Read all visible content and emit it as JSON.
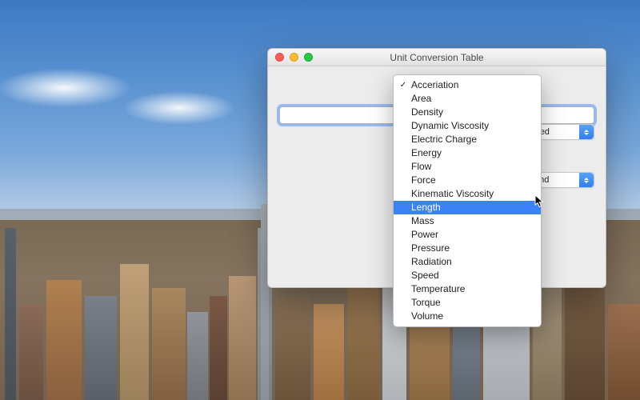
{
  "window": {
    "title": "Unit Conversion Table"
  },
  "input": {
    "value": ""
  },
  "quantity_select": {
    "selected": "Acceriation",
    "options": [
      {
        "label": "Acceriation",
        "checked": true,
        "highlighted": false
      },
      {
        "label": "Area",
        "checked": false,
        "highlighted": false
      },
      {
        "label": "Density",
        "checked": false,
        "highlighted": false
      },
      {
        "label": "Dynamic Viscosity",
        "checked": false,
        "highlighted": false
      },
      {
        "label": "Electric Charge",
        "checked": false,
        "highlighted": false
      },
      {
        "label": "Energy",
        "checked": false,
        "highlighted": false
      },
      {
        "label": "Flow",
        "checked": false,
        "highlighted": false
      },
      {
        "label": "Force",
        "checked": false,
        "highlighted": false
      },
      {
        "label": "Kinematic Viscosity",
        "checked": false,
        "highlighted": false
      },
      {
        "label": "Length",
        "checked": false,
        "highlighted": true
      },
      {
        "label": "Mass",
        "checked": false,
        "highlighted": false
      },
      {
        "label": "Power",
        "checked": false,
        "highlighted": false
      },
      {
        "label": "Pressure",
        "checked": false,
        "highlighted": false
      },
      {
        "label": "Radiation",
        "checked": false,
        "highlighted": false
      },
      {
        "label": "Speed",
        "checked": false,
        "highlighted": false
      },
      {
        "label": "Temperature",
        "checked": false,
        "highlighted": false
      },
      {
        "label": "Torque",
        "checked": false,
        "highlighted": false
      },
      {
        "label": "Volume",
        "checked": false,
        "highlighted": false
      }
    ]
  },
  "from_unit": {
    "visible_suffix": "d squared"
  },
  "to_unit": {
    "visible_suffix": "er second"
  }
}
